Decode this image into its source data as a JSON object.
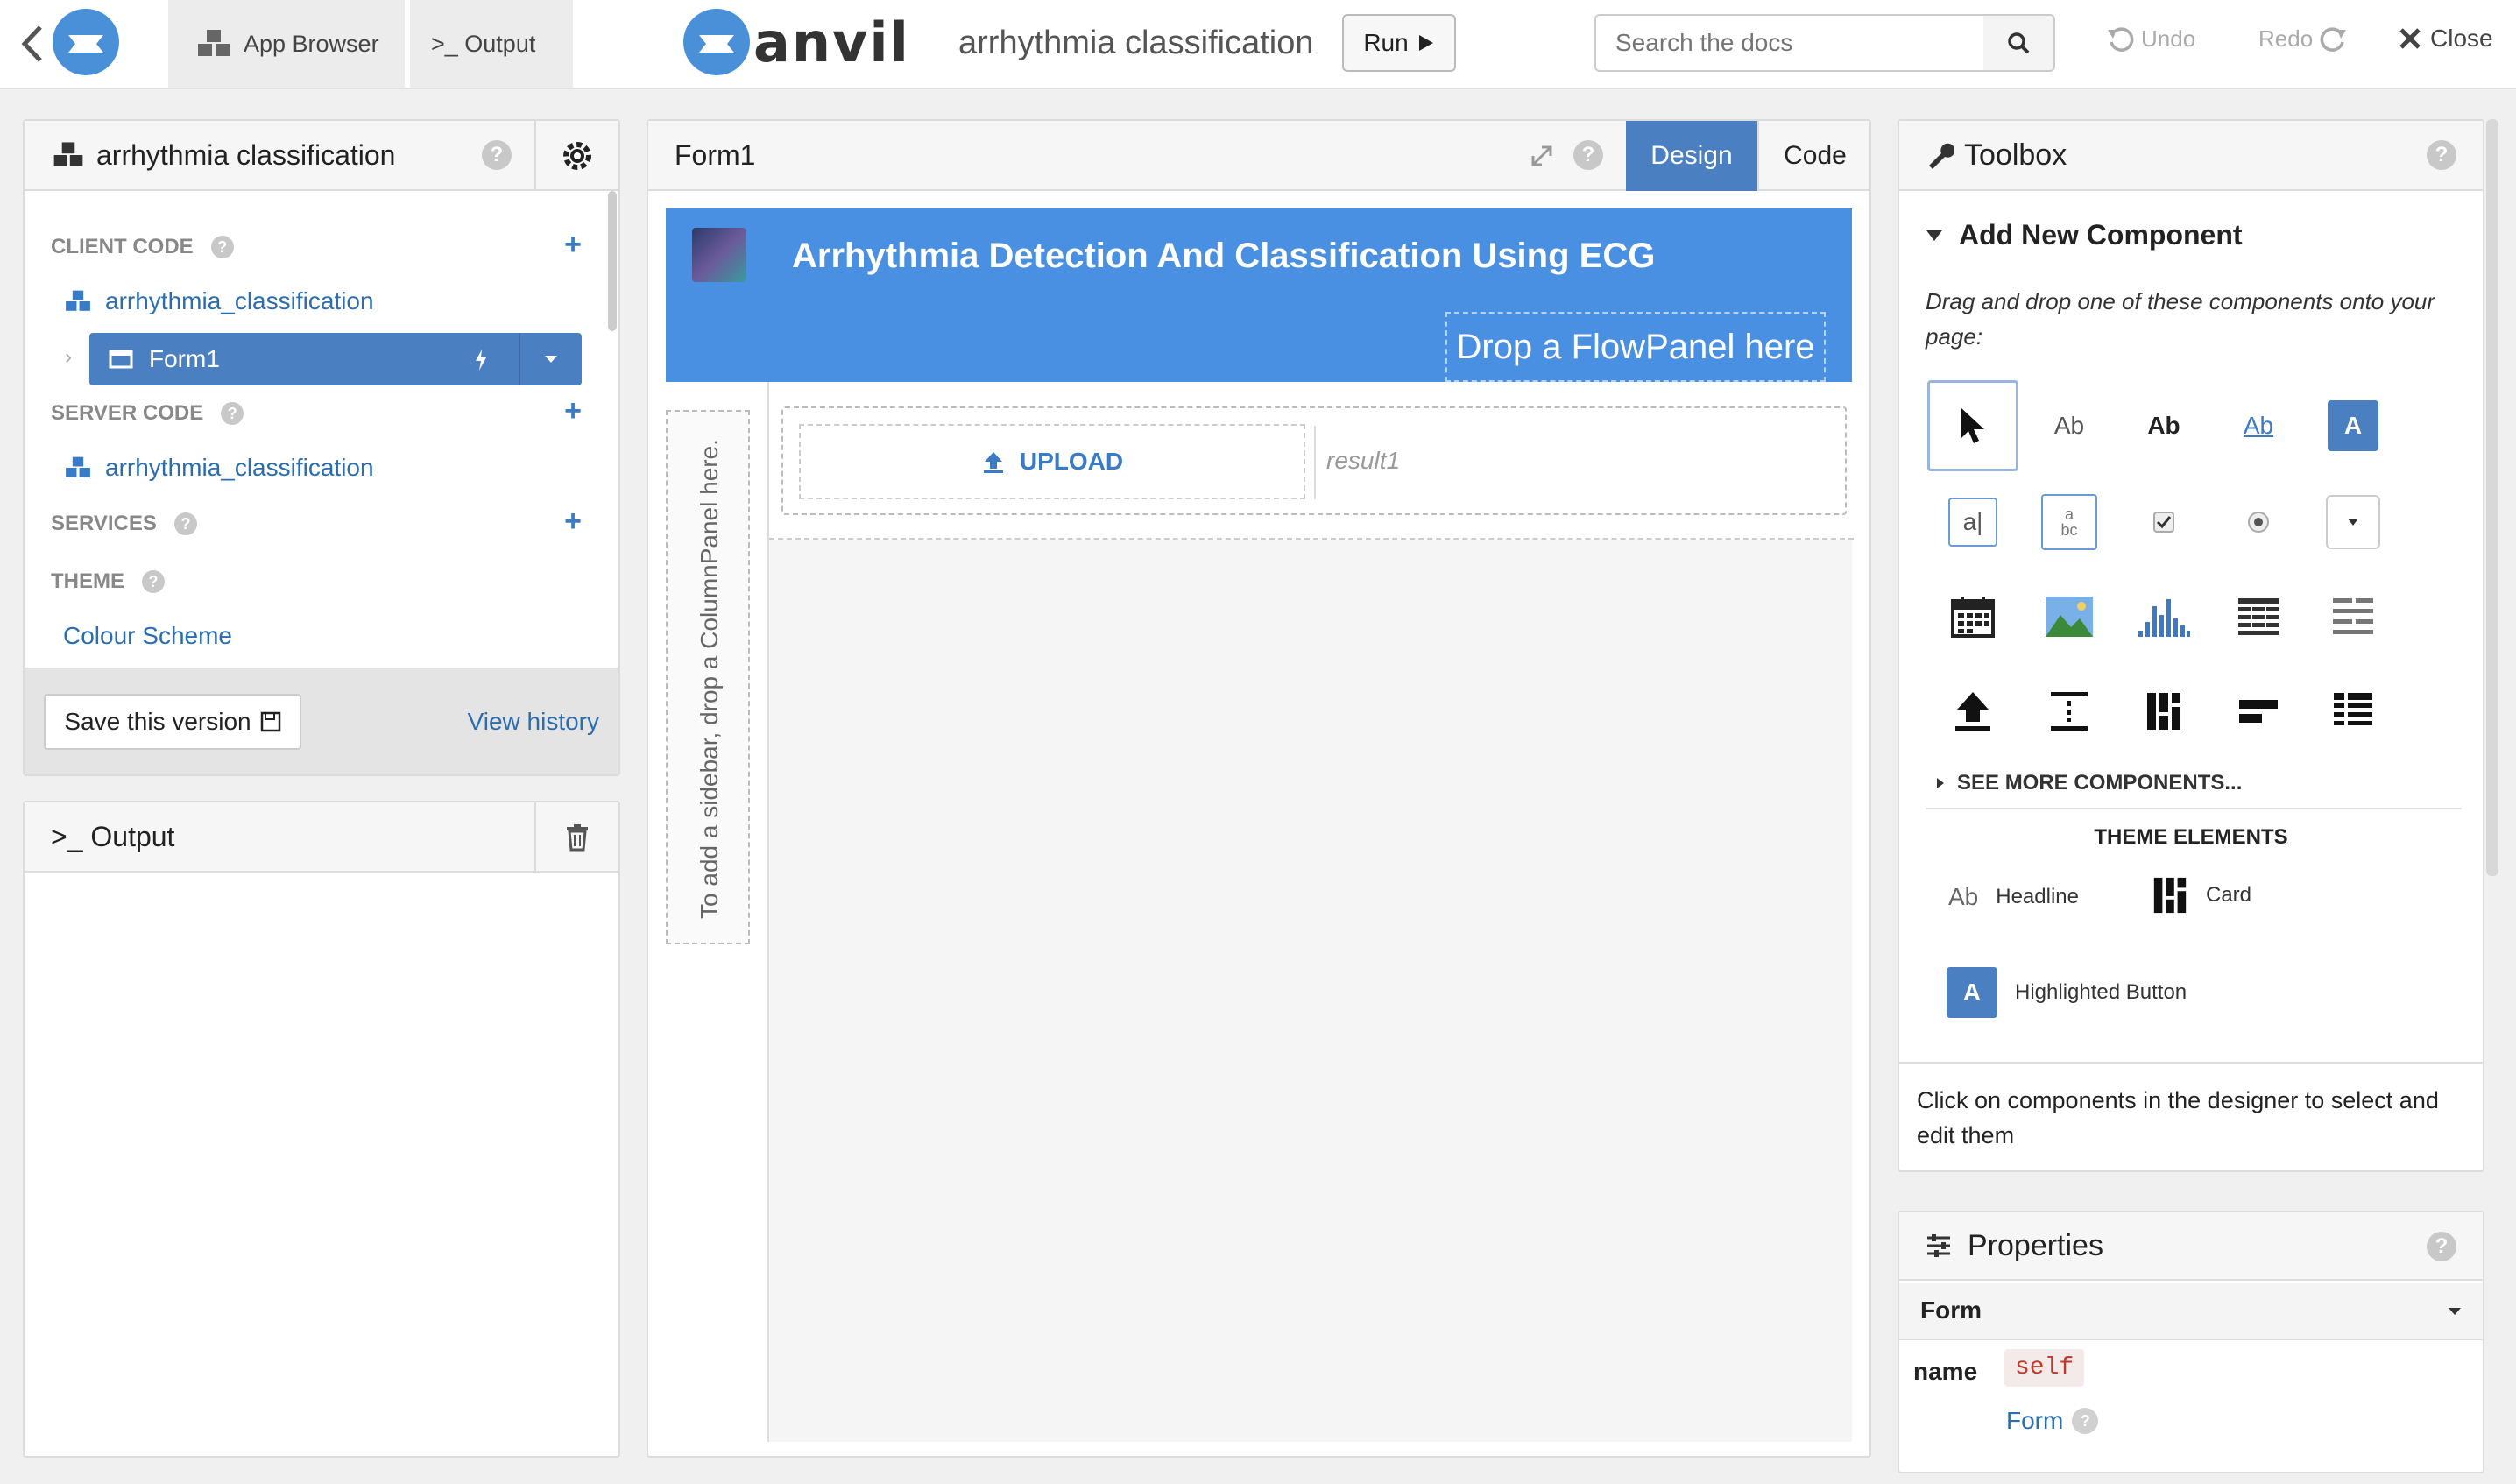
{
  "topbar": {
    "app_browser": "App Browser",
    "output": ">_ Output",
    "logo_text": "anvil",
    "project_title": "arrhythmia classification",
    "run": "Run",
    "search_placeholder": "Search the docs",
    "undo": "Undo",
    "redo": "Redo",
    "close": "Close"
  },
  "app_panel": {
    "title": "arrhythmia classification",
    "client_code": "CLIENT CODE",
    "client_module": "arrhythmia_classification",
    "form1": "Form1",
    "server_code": "SERVER CODE",
    "server_module": "arrhythmia_classification",
    "services": "SERVICES",
    "theme": "THEME",
    "colour_scheme": "Colour Scheme",
    "save_version": "Save this version",
    "view_history": "View history"
  },
  "output_panel": {
    "title": ">_ Output"
  },
  "form_panel": {
    "title": "Form1",
    "design_tab": "Design",
    "code_tab": "Code",
    "header_title": "Arrhythmia Detection And Classification Using ECG",
    "flowpanel_drop": "Drop a FlowPanel here",
    "sidebar_hint": "To add a sidebar, drop a ColumnPanel here.",
    "upload_label": "UPLOAD",
    "result_label": "result1"
  },
  "toolbox": {
    "title": "Toolbox",
    "add_new": "Add New Component",
    "drag_text": "Drag and drop one of these components onto your page:",
    "see_more": "SEE MORE COMPONENTS...",
    "theme_elements": "THEME ELEMENTS",
    "headline": "Headline",
    "card": "Card",
    "highlighted_button": "Highlighted Button",
    "footer_text": "Click on components in the designer to select and edit them",
    "components": [
      "pointer-icon",
      "label",
      "bold-label",
      "link",
      "button",
      "textbox",
      "textarea",
      "checkbox",
      "radio-button",
      "dropdown",
      "datepicker",
      "image",
      "plot",
      "data-grid",
      "repeating-panel",
      "file-loader",
      "spacer",
      "column-panel",
      "linear-panel",
      "grid-panel"
    ]
  },
  "properties": {
    "title": "Properties",
    "selected": "Form",
    "name_label": "name",
    "name_value": "self",
    "form_link": "Form"
  },
  "colors": {
    "accent": "#4a7fc1",
    "header_blue": "#4a90e2",
    "link": "#2a6db0"
  }
}
